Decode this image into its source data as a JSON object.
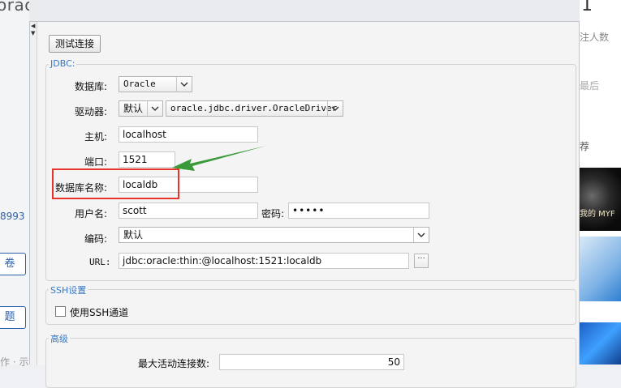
{
  "background": {
    "title": "oracle   这么设置是对的吗",
    "left_items": [
      "8993",
      "卷",
      "题",
      "作 · 示"
    ],
    "right_count": "1",
    "right_labels": [
      "注人数",
      "最后",
      "荐"
    ],
    "thumbnail_text": "我的 MYF"
  },
  "dialog": {
    "test_button_label": "测试连接",
    "jdbc_group": {
      "title": "JDBC:",
      "database_label": "数据库:",
      "database_value": "Oracle",
      "driver_label": "驱动器:",
      "driver_mode_value": "默认",
      "driver_class_value": "oracle.jdbc.driver.OracleDriver",
      "host_label": "主机:",
      "host_value": "localhost",
      "port_label": "端口:",
      "port_value": "1521",
      "dbname_label": "数据库名称:",
      "dbname_value": "localdb",
      "username_label": "用户名:",
      "username_value": "scott",
      "password_label": "密码:",
      "password_value": "•••••",
      "encoding_label": "编码:",
      "encoding_value": "默认",
      "url_label": "URL:",
      "url_value": "jdbc:oracle:thin:@localhost:1521:localdb",
      "url_more_label": "···"
    },
    "ssh_group": {
      "title": "SSH设置",
      "use_ssh_label": "使用SSH通道",
      "use_ssh_checked": false
    },
    "advanced_group": {
      "title": "高级",
      "max_active_label": "最大活动连接数:",
      "max_active_value": "50"
    }
  },
  "colors": {
    "annotation_box": "#e8322c",
    "annotation_arrow": "#3a9a3a",
    "group_title": "#3478c6"
  }
}
